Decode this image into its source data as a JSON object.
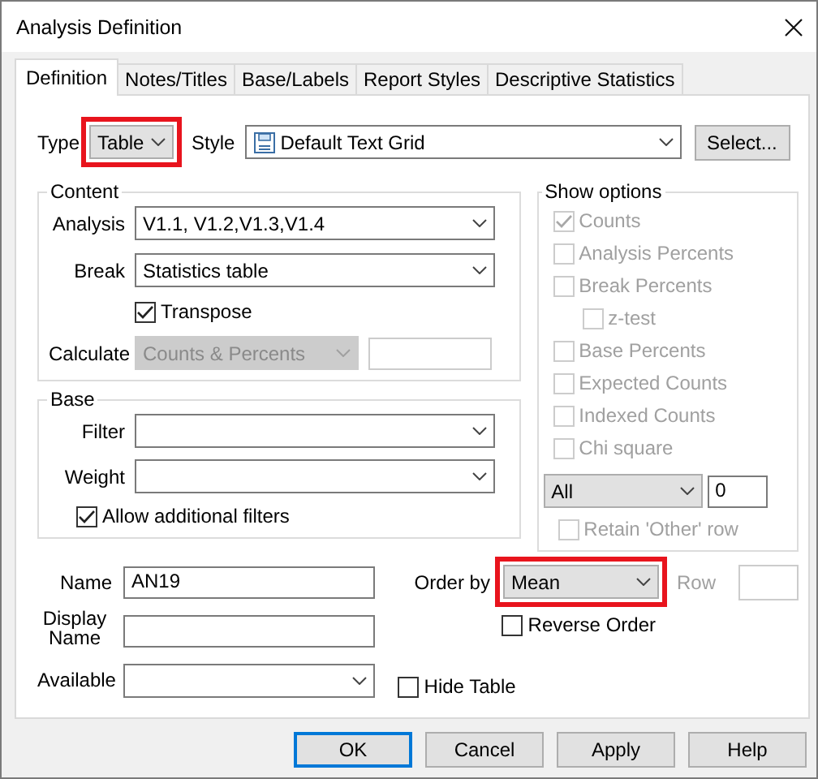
{
  "window": {
    "title": "Analysis Definition"
  },
  "tabs": [
    {
      "label": "Definition",
      "selected": true
    },
    {
      "label": "Notes/Titles",
      "selected": false
    },
    {
      "label": "Base/Labels",
      "selected": false
    },
    {
      "label": "Report Styles",
      "selected": false
    },
    {
      "label": "Descriptive Statistics",
      "selected": false
    }
  ],
  "type": {
    "label": "Type",
    "value": "Table",
    "highlighted": true
  },
  "style": {
    "label": "Style",
    "value": "Default Text Grid"
  },
  "select_button": "Select...",
  "content": {
    "title": "Content",
    "analysis": {
      "label": "Analysis",
      "value": "V1.1, V1.2,V1.3,V1.4"
    },
    "break": {
      "label": "Break",
      "value": "Statistics table"
    },
    "transpose": {
      "label": "Transpose",
      "checked": true
    },
    "calculate": {
      "label": "Calculate",
      "value": "Counts & Percents",
      "disabled": true
    }
  },
  "base": {
    "title": "Base",
    "filter": {
      "label": "Filter"
    },
    "weight": {
      "label": "Weight"
    },
    "allow_additional_filters": {
      "label": "Allow additional filters",
      "checked": true
    }
  },
  "show_options": {
    "title": "Show options",
    "options": [
      {
        "label": "Counts",
        "checked": true,
        "disabled": true
      },
      {
        "label": "Analysis Percents",
        "checked": false,
        "disabled": true
      },
      {
        "label": "Break Percents",
        "checked": false,
        "disabled": true,
        "children": [
          {
            "label": "z-test",
            "checked": false,
            "disabled": true
          }
        ]
      },
      {
        "label": "Base Percents",
        "checked": false,
        "disabled": true
      },
      {
        "label": "Expected Counts",
        "checked": false,
        "disabled": true
      },
      {
        "label": "Indexed Counts",
        "checked": false,
        "disabled": true
      },
      {
        "label": "Chi square",
        "checked": false,
        "disabled": true
      }
    ],
    "top": {
      "value": "All"
    },
    "top_count": {
      "value": "0"
    },
    "retain_other_row": {
      "label": "Retain 'Other' row",
      "checked": false,
      "disabled": true
    }
  },
  "name": {
    "label": "Name",
    "value": "AN19"
  },
  "display_name": {
    "label": "Display Name"
  },
  "available": {
    "label": "Available"
  },
  "order_by": {
    "label": "Order by",
    "value": "Mean",
    "highlighted": true
  },
  "row": {
    "label": "Row",
    "disabled": true
  },
  "reverse_order": {
    "label": "Reverse Order",
    "checked": false
  },
  "hide_table": {
    "label": "Hide Table",
    "checked": false
  },
  "buttons": [
    {
      "label": "OK",
      "default": true
    },
    {
      "label": "Cancel",
      "default": false
    },
    {
      "label": "Apply",
      "default": false
    },
    {
      "label": "Help",
      "default": false
    }
  ]
}
